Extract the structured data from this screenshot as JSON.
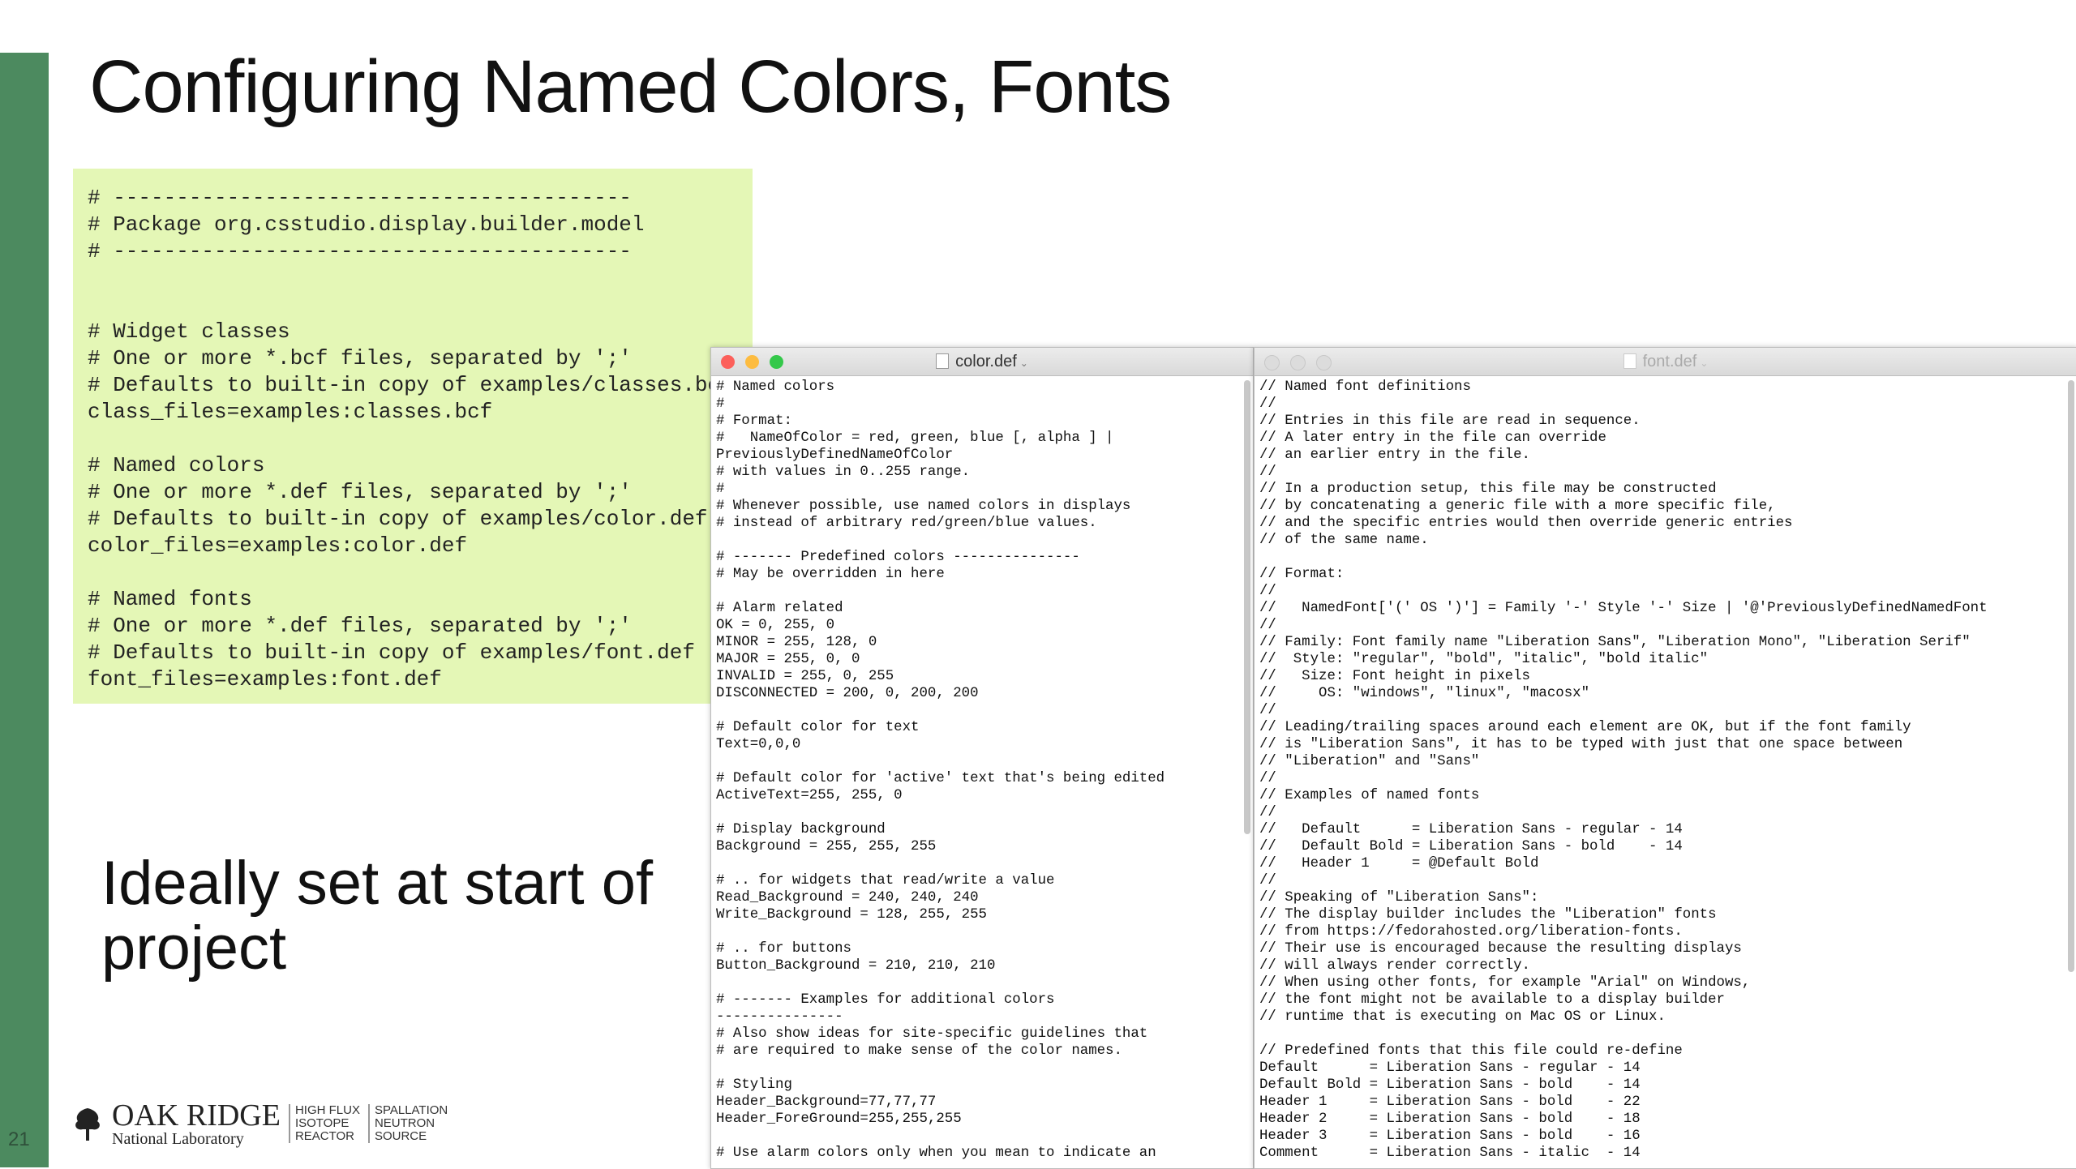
{
  "slide": {
    "number": "21",
    "title": "Configuring Named Colors, Fonts",
    "note": "Ideally set at start of project",
    "config_text": "# -----------------------------------------\n# Package org.csstudio.display.builder.model\n# -----------------------------------------\n\n\n# Widget classes\n# One or more *.bcf files, separated by ';'\n# Defaults to built-in copy of examples/classes.bcf\nclass_files=examples:classes.bcf\n\n# Named colors\n# One or more *.def files, separated by ';'\n# Defaults to built-in copy of examples/color.def\ncolor_files=examples:color.def\n\n# Named fonts\n# One or more *.def files, separated by ';'\n# Defaults to built-in copy of examples/font.def\nfont_files=examples:font.def"
  },
  "logo": {
    "name_line1": "OAK RIDGE",
    "name_line2": "National Laboratory",
    "hfir": [
      "HIGH FLUX",
      "ISOTOPE",
      "REACTOR"
    ],
    "sns": [
      "SPALLATION",
      "NEUTRON",
      "SOURCE"
    ]
  },
  "color_window": {
    "title": "color.def",
    "content": "# Named colors\n#\n# Format:\n#   NameOfColor = red, green, blue [, alpha ] |\nPreviouslyDefinedNameOfColor\n# with values in 0..255 range.\n#\n# Whenever possible, use named colors in displays\n# instead of arbitrary red/green/blue values.\n\n# ------- Predefined colors ---------------\n# May be overridden in here\n\n# Alarm related\nOK = 0, 255, 0\nMINOR = 255, 128, 0\nMAJOR = 255, 0, 0\nINVALID = 255, 0, 255\nDISCONNECTED = 200, 0, 200, 200\n\n# Default color for text\nText=0,0,0\n\n# Default color for 'active' text that's being edited\nActiveText=255, 255, 0\n\n# Display background\nBackground = 255, 255, 255\n\n# .. for widgets that read/write a value\nRead_Background = 240, 240, 240\nWrite_Background = 128, 255, 255\n\n# .. for buttons\nButton_Background = 210, 210, 210\n\n# ------- Examples for additional colors\n---------------\n# Also show ideas for site-specific guidelines that\n# are required to make sense of the color names.\n\n# Styling\nHeader_Background=77,77,77\nHeader_ForeGround=255,255,255\n\n# Use alarm colors only when you mean to indicate an"
  },
  "font_window": {
    "title": "font.def",
    "content": "// Named font definitions\n//\n// Entries in this file are read in sequence.\n// A later entry in the file can override\n// an earlier entry in the file.\n//\n// In a production setup, this file may be constructed\n// by concatenating a generic file with a more specific file,\n// and the specific entries would then override generic entries\n// of the same name.\n\n// Format:\n//\n//   NamedFont['(' OS ')'] = Family '-' Style '-' Size | '@'PreviouslyDefinedNamedFont\n//\n// Family: Font family name \"Liberation Sans\", \"Liberation Mono\", \"Liberation Serif\"\n//  Style: \"regular\", \"bold\", \"italic\", \"bold italic\"\n//   Size: Font height in pixels\n//     OS: \"windows\", \"linux\", \"macosx\"\n//\n// Leading/trailing spaces around each element are OK, but if the font family\n// is \"Liberation Sans\", it has to be typed with just that one space between\n// \"Liberation\" and \"Sans\"\n//\n// Examples of named fonts\n//\n//   Default      = Liberation Sans - regular - 14\n//   Default Bold = Liberation Sans - bold    - 14\n//   Header 1     = @Default Bold\n//\n// Speaking of \"Liberation Sans\":\n// The display builder includes the \"Liberation\" fonts\n// from https://fedorahosted.org/liberation-fonts.\n// Their use is encouraged because the resulting displays\n// will always render correctly.\n// When using other fonts, for example \"Arial\" on Windows,\n// the font might not be available to a display builder\n// runtime that is executing on Mac OS or Linux.\n\n// Predefined fonts that this file could re-define\nDefault      = Liberation Sans - regular - 14\nDefault Bold = Liberation Sans - bold    - 14\nHeader 1     = Liberation Sans - bold    - 22\nHeader 2     = Liberation Sans - bold    - 18\nHeader 3     = Liberation Sans - bold    - 16\nComment      = Liberation Sans - italic  - 14"
  },
  "colors": {
    "sidebar": "#4c8a5f",
    "config_bg": "#e4f7b6",
    "close": "#fc605b",
    "minimize": "#fdbc40",
    "zoom": "#34c84a",
    "inactive": "#dcdcdc"
  }
}
